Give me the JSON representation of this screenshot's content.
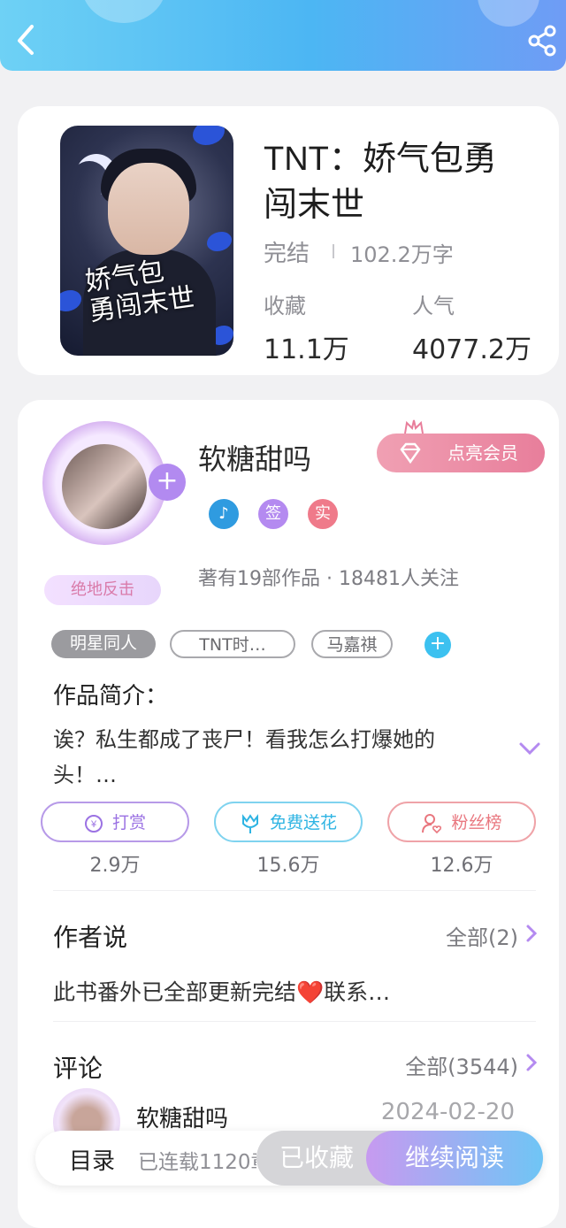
{
  "header": {
    "back_icon": "chevron-left-icon",
    "share_icon": "share-icon"
  },
  "book": {
    "cover_text": "娇气包\n勇闯末世",
    "title": "TNT：娇气包勇闯末世",
    "status": "完结",
    "words": "102.2万字",
    "favorites_label": "收藏",
    "favorites_value": "11.1万",
    "popularity_label": "人气",
    "popularity_value": "4077.2万"
  },
  "author": {
    "name": "软糖甜吗",
    "title_badge": "绝地反击",
    "vip_button": "点亮会员",
    "badges": [
      {
        "label": "",
        "icon": "medal-icon",
        "color": "#2f9be0"
      },
      {
        "label": "签",
        "color": "#b48af0"
      },
      {
        "label": "实",
        "color": "#ef7a8a"
      }
    ],
    "meta": "著有19部作品 · 18481人关注"
  },
  "tags": [
    "明星同人",
    "TNT时…",
    "马嘉祺"
  ],
  "intro": {
    "label": "作品简介：",
    "text": "诶？私生都成了丧尸！看我怎么打爆她的头！…"
  },
  "actions": [
    {
      "label": "打赏",
      "count": "2.9万",
      "icon": "yen-coin-icon",
      "color": "#a07be8"
    },
    {
      "label": "免费送花",
      "count": "15.6万",
      "icon": "tulip-icon",
      "color": "#3fbde8"
    },
    {
      "label": "粉丝榜",
      "count": "12.6万",
      "icon": "fan-user-icon",
      "color": "#e9777f"
    }
  ],
  "author_says": {
    "title": "作者说",
    "link": "全部(2)",
    "text": "此书番外已全部更新完结❤️联系…"
  },
  "comments": {
    "title": "评论",
    "link": "全部(3544)",
    "first": {
      "name": "软糖甜吗",
      "date": "2024-02-20"
    }
  },
  "bottom_bar": {
    "toc": "目录",
    "progress": "已连载1120章",
    "collected": "已收藏",
    "continue": "继续阅读"
  }
}
